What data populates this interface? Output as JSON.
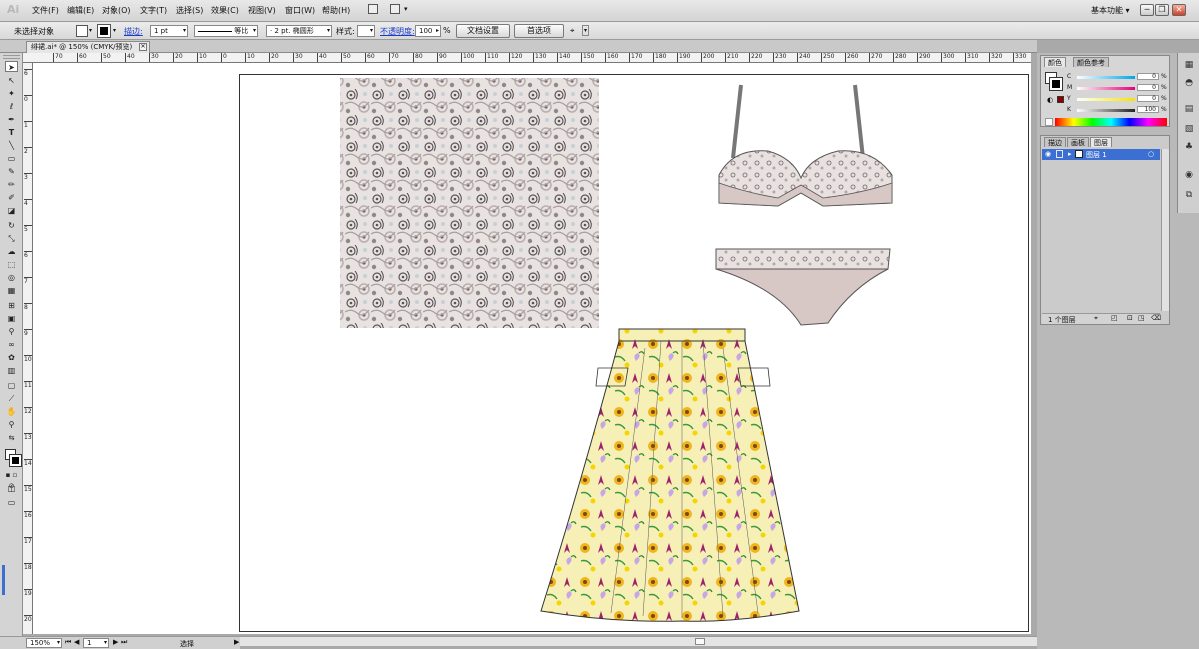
{
  "app": {
    "logo": "Ai",
    "workspace": "基本功能"
  },
  "menu": [
    "文件(F)",
    "编辑(E)",
    "对象(O)",
    "文字(T)",
    "选择(S)",
    "效果(C)",
    "视图(V)",
    "窗口(W)",
    "帮助(H)"
  ],
  "window_buttons": {
    "minimize": "─",
    "restore": "❐",
    "close": "✕"
  },
  "control": {
    "selection_status": "未选择对象",
    "stroke_label": "描边:",
    "stroke_weight": "1 pt",
    "stroke_profile": "等比",
    "brush": "2 pt. 椭圆形",
    "style_label": "样式:",
    "opacity_label": "不透明度:",
    "opacity_value": "100",
    "opacity_unit": "%",
    "doc_setup_button": "文档设置",
    "prefs_button": "首选项"
  },
  "doc_tab": {
    "title": "绯裙.ai* @ 150% (CMYK/预览)",
    "close": "✕"
  },
  "ruler_top": [
    "70",
    "60",
    "50",
    "40",
    "30",
    "20",
    "10",
    "0",
    "10",
    "20",
    "30",
    "40",
    "50",
    "60",
    "70",
    "80",
    "90",
    "100",
    "110",
    "120",
    "130",
    "140",
    "150",
    "160",
    "170",
    "180",
    "190",
    "200",
    "210",
    "220",
    "230",
    "240",
    "250",
    "260",
    "270",
    "280",
    "290",
    "300",
    "310",
    "320",
    "330",
    "340"
  ],
  "ruler_left": [
    "6",
    "0",
    "1",
    "2",
    "3",
    "4",
    "5",
    "6",
    "7",
    "8",
    "9",
    "10",
    "11",
    "12",
    "13",
    "14",
    "15",
    "16",
    "17",
    "18",
    "19",
    "20"
  ],
  "status": {
    "zoom": "150%",
    "page": "1",
    "tool": "选择"
  },
  "color_panel": {
    "tabs": [
      "颜色",
      "颜色参考"
    ],
    "channels": [
      {
        "label": "C",
        "value": "0",
        "unit": "%",
        "color": "#00a6e8"
      },
      {
        "label": "M",
        "value": "0",
        "unit": "%",
        "color": "#e2007a"
      },
      {
        "label": "Y",
        "value": "0",
        "unit": "%",
        "color": "#f5e400"
      },
      {
        "label": "K",
        "value": "100",
        "unit": "%",
        "color": "#222222"
      }
    ]
  },
  "layers_panel": {
    "tabs": [
      "描边",
      "画板",
      "图层"
    ],
    "layers": [
      {
        "name": "图层 1"
      }
    ],
    "count": "1 个图层"
  },
  "colors": {
    "selection_blue": "#3b6fd1",
    "skirt_yellow": "#f5f0b5",
    "lace_grey": "#cdc3c0",
    "lingerie_mauve": "#d7c8c6"
  }
}
